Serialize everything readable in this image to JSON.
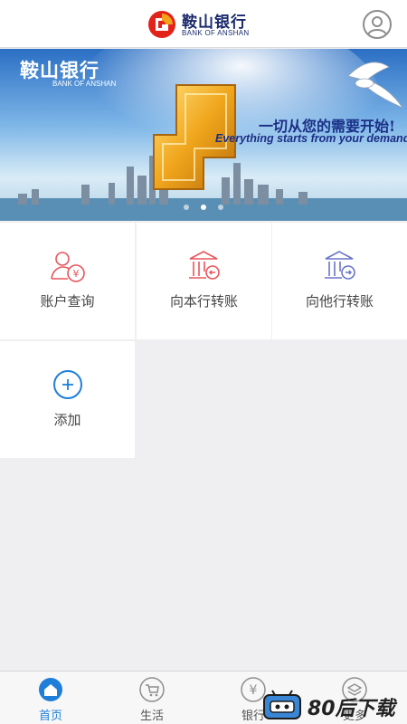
{
  "header": {
    "bank_name_cn": "鞍山银行",
    "bank_name_en": "BANK OF ANSHAN",
    "user_icon": "user-avatar-icon"
  },
  "banner": {
    "logo_cn": "鞍山银行",
    "logo_en": "BANK OF ANSHAN",
    "slogan_cn": "一切从您的需要开始!",
    "slogan_en": "Everything starts from your demand",
    "slide_count": 3,
    "active_slide": 1
  },
  "services": [
    {
      "label": "账户查询",
      "icon": "account-query-icon"
    },
    {
      "label": "向本行转账",
      "icon": "transfer-same-bank-icon"
    },
    {
      "label": "向他行转账",
      "icon": "transfer-other-bank-icon"
    },
    {
      "label": "添加",
      "icon": "add-icon"
    }
  ],
  "tabbar": {
    "items": [
      {
        "label": "首页",
        "icon": "home-icon",
        "active": true
      },
      {
        "label": "生活",
        "icon": "cart-icon",
        "active": false
      },
      {
        "label": "银行",
        "icon": "yen-icon",
        "active": false
      },
      {
        "label": "更多",
        "icon": "layers-icon",
        "active": false
      }
    ]
  },
  "watermark": {
    "text": "80后下载"
  },
  "colors": {
    "brand_blue": "#1a2a6c",
    "tab_active": "#1f7fd8",
    "icon_red": "#e8555b",
    "icon_purple": "#6a75c9",
    "icon_blue": "#1f7fd8"
  }
}
